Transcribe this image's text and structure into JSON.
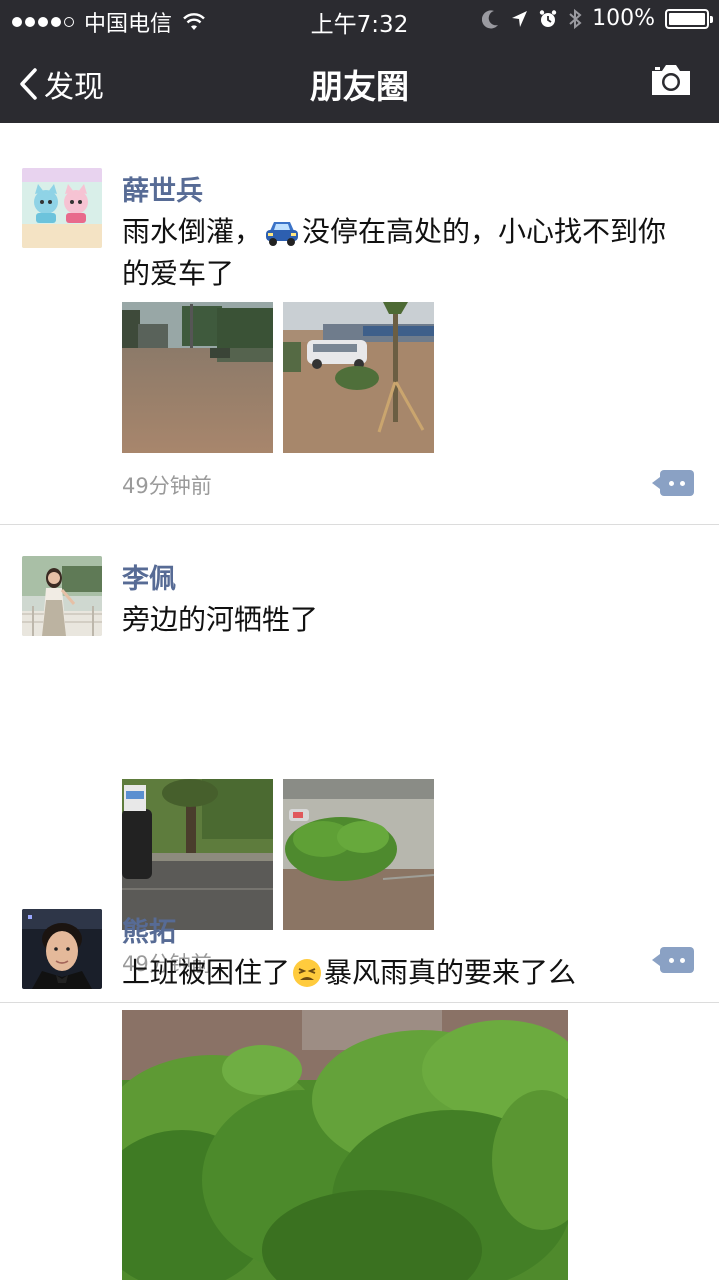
{
  "status_bar": {
    "carrier": "中国电信",
    "time": "上午7:32",
    "battery": "100%"
  },
  "nav": {
    "back_label": "发现",
    "title": "朋友圈"
  },
  "posts": [
    {
      "name": "薛世兵",
      "text_before_emoji": "雨水倒灌，",
      "emoji": "car-emoji",
      "text_after_emoji": "没停在高处的，小心找不到你的爱车了",
      "time": "49分钟前",
      "images": [
        "flooded-street-photo",
        "flooded-road-van-photo"
      ]
    },
    {
      "name": "李佩",
      "text": "旁边的河牺牲了",
      "time": "49分钟前",
      "images": [
        "flooded-park-photo",
        "flooded-bush-photo"
      ]
    },
    {
      "name": "熊拓",
      "text_before_emoji": "上班被困住了",
      "emoji": "tired-face-emoji",
      "text_after_emoji": "暴风雨真的要来了么",
      "images": [
        "storm-trees-photo"
      ]
    }
  ],
  "colors": {
    "nav_background": "#2b2b30",
    "name_blue": "#576b95",
    "time_gray": "#9a9a9a",
    "comment_button": "#8aa1c4"
  }
}
